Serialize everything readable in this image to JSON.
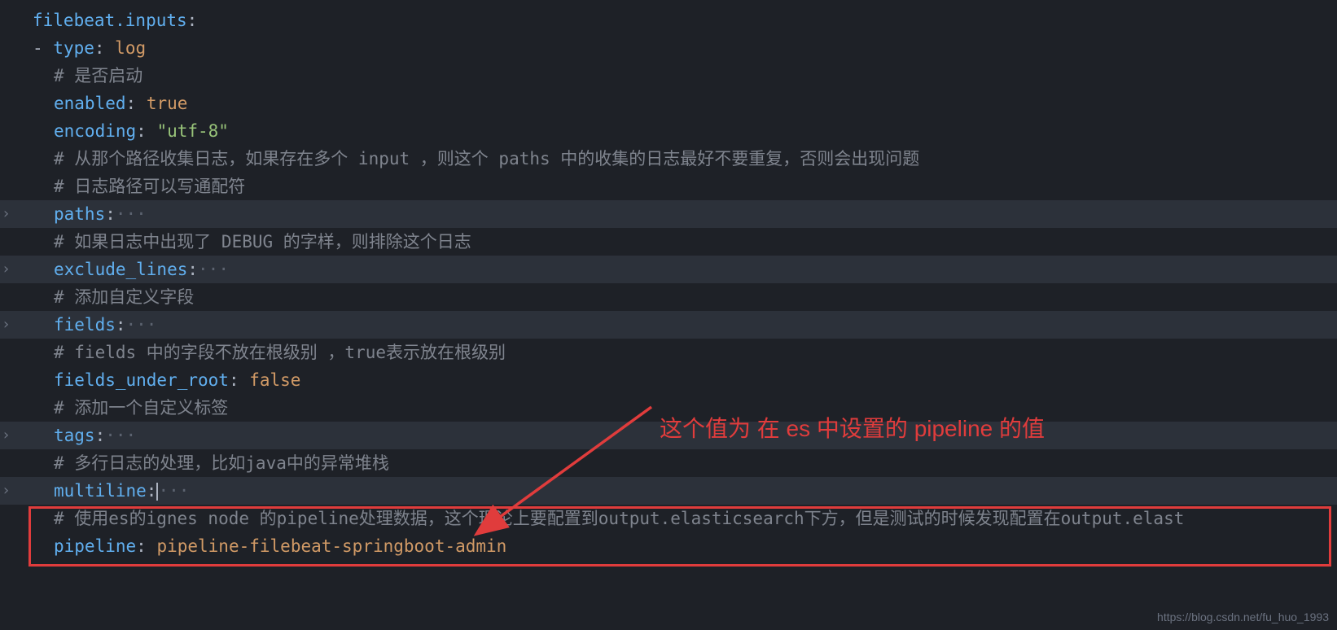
{
  "code": {
    "line1_key": "filebeat.inputs",
    "line2_dash": "- ",
    "line2_key": "type",
    "line2_val": "log",
    "line3_comment": "# 是否启动",
    "line4_key": "enabled",
    "line4_val": "true",
    "line5_key": "encoding",
    "line5_val": "\"utf-8\"",
    "line6_comment": "# 从那个路径收集日志，如果存在多个 input ，则这个 paths 中的收集的日志最好不要重复，否则会出现问题",
    "line7_comment": "# 日志路径可以写通配符",
    "line8_key": "paths",
    "line8_ellipsis": "···",
    "line9_comment": "# 如果日志中出现了 DEBUG 的字样，则排除这个日志",
    "line10_key": "exclude_lines",
    "line10_ellipsis": "···",
    "line11_comment": "# 添加自定义字段",
    "line12_key": "fields",
    "line12_ellipsis": "···",
    "line13_comment": "# fields 中的字段不放在根级别 ，true表示放在根级别",
    "line14_key": "fields_under_root",
    "line14_val": "false",
    "line15_comment": "# 添加一个自定义标签",
    "line16_key": "tags",
    "line16_ellipsis": "···",
    "line17_comment": "# 多行日志的处理，比如java中的异常堆栈",
    "line18_key": "multiline",
    "line18_ellipsis": "···",
    "line19_comment": "# 使用es的ignes node 的pipeline处理数据，这个理论上要配置到output.elasticsearch下方，但是测试的时候发现配置在output.elast",
    "line20_key": "pipeline",
    "line20_val": "pipeline-filebeat-springboot-admin"
  },
  "annotation": "这个值为 在 es 中设置的 pipeline 的值",
  "watermark": "https://blog.csdn.net/fu_huo_1993"
}
